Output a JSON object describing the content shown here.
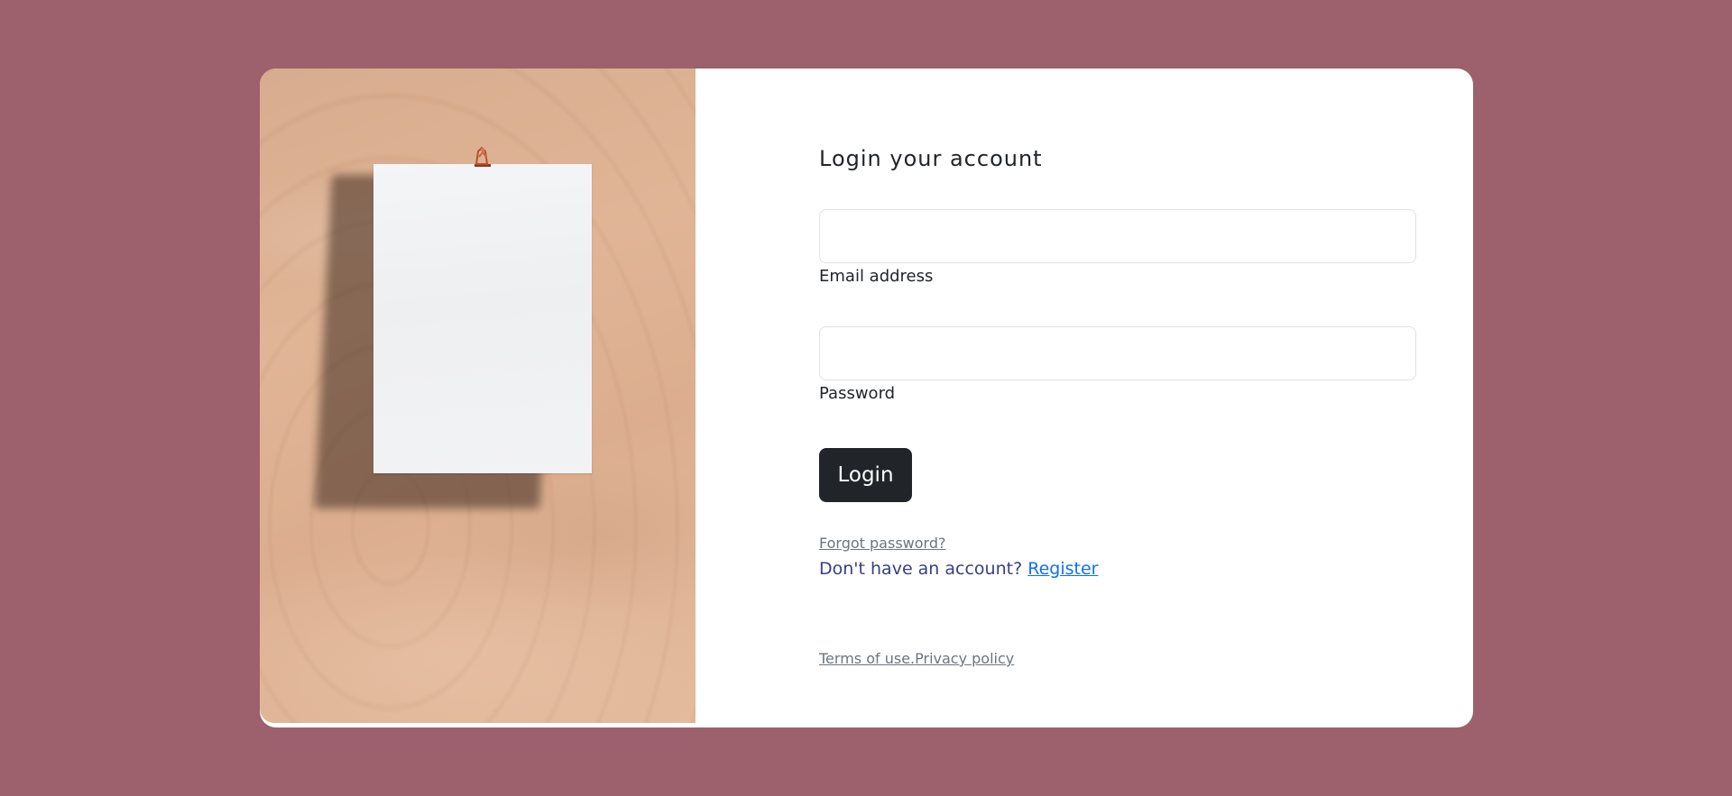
{
  "page": {
    "background_color": "#9c616c",
    "card_color": "#ffffff"
  },
  "photo": {
    "icon": "paper-note-photo"
  },
  "form": {
    "heading": "Login your account",
    "email": {
      "label": "Email address",
      "value": "",
      "placeholder": ""
    },
    "password": {
      "label": "Password",
      "value": "",
      "placeholder": ""
    },
    "login_button": "Login",
    "forgot_password": "Forgot password?",
    "no_account_text": "Don't have an account?",
    "register_link": "Register",
    "terms_link": "Terms of use.",
    "privacy_link": "Privacy policy",
    "button_color": "#212529",
    "link_color": "#0d6efd"
  }
}
